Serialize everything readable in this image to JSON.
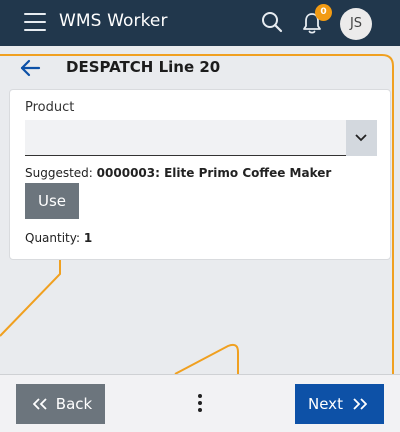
{
  "header": {
    "app_title": "WMS Worker",
    "notification_count": "0",
    "avatar_initials": "JS"
  },
  "page": {
    "title": "DESPATCH Line 20"
  },
  "form": {
    "product_label": "Product",
    "product_value": "",
    "suggested_label": "Suggested:",
    "suggested_value": "0000003: Elite Primo Coffee Maker",
    "use_button": "Use",
    "quantity_label": "Quantity:",
    "quantity_value": "1"
  },
  "footer": {
    "back_label": "Back",
    "next_label": "Next"
  },
  "colors": {
    "topbar": "#21374c",
    "badge": "#f29b13",
    "next_button": "#0d51a7",
    "secondary_button": "#6c757d",
    "accent_lines": "#f0a020"
  }
}
